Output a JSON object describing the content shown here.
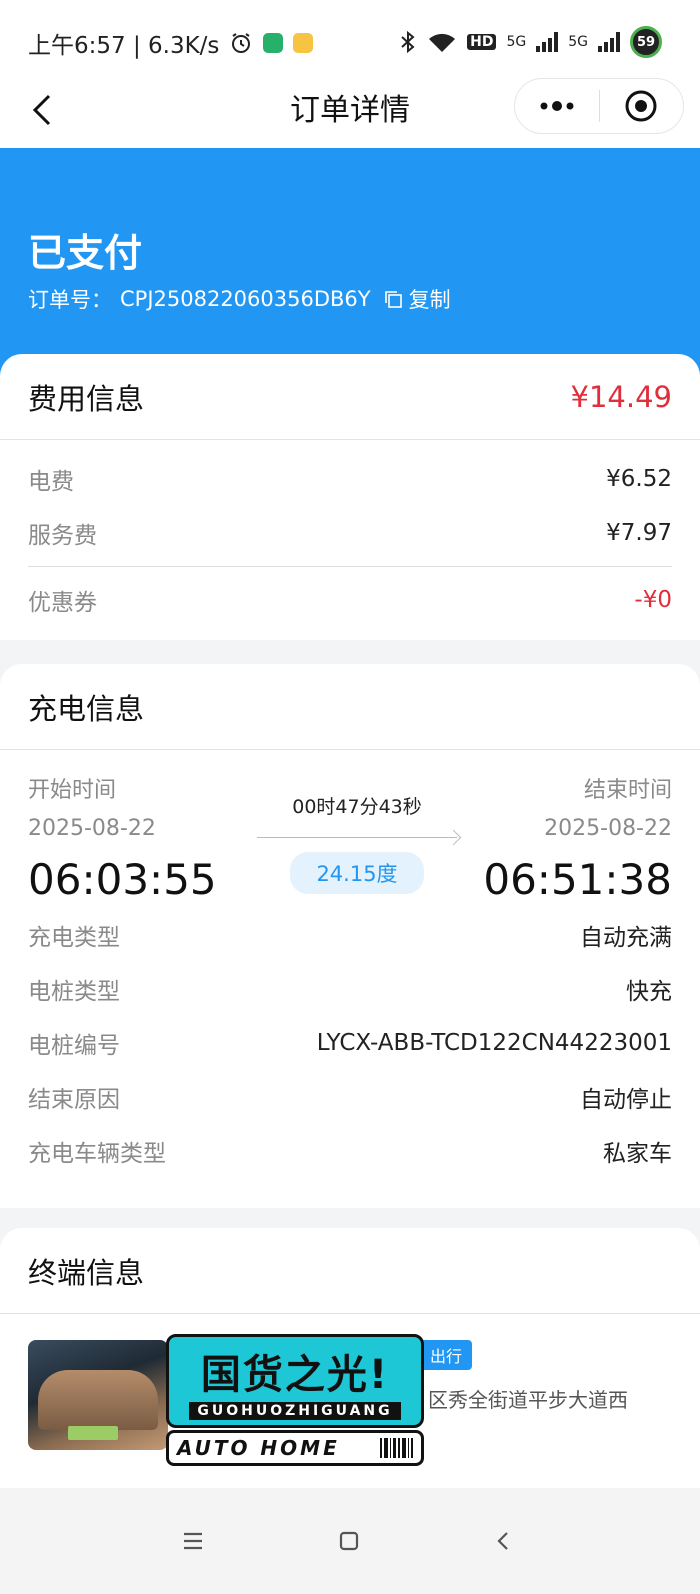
{
  "status_bar": {
    "time_speed": "上午6:57 | 6.3K/s",
    "battery": "59",
    "network_labels": [
      "HD",
      "5G",
      "5G"
    ]
  },
  "nav": {
    "title": "订单详情",
    "icons": [
      "back-icon",
      "more-icon",
      "close-target-icon"
    ]
  },
  "header": {
    "status": "已支付",
    "order_label": "订单号：",
    "order_no": "CPJ250822060356DB6Y",
    "copy_label": "复制",
    "bg_color": "#2196f3"
  },
  "fee": {
    "title": "费用信息",
    "total": "¥14.49",
    "rows": [
      {
        "key": "电费",
        "value": "¥6.52"
      },
      {
        "key": "服务费",
        "value": "¥7.97"
      }
    ],
    "coupon": {
      "key": "优惠券",
      "value": "-¥0"
    },
    "accent": "#e02e3a"
  },
  "charge": {
    "title": "充电信息",
    "start_label": "开始时间",
    "start_date": "2025-08-22",
    "start_time": "06:03:55",
    "end_label": "结束时间",
    "end_date": "2025-08-22",
    "end_time": "06:51:38",
    "duration": "00时47分43秒",
    "energy": "24.15度",
    "rows": [
      {
        "key": "充电类型",
        "value": "自动充满"
      },
      {
        "key": "电桩类型",
        "value": "快充"
      },
      {
        "key": "电桩编号",
        "value": "LYCX-ABB-TCD122CN44223001"
      },
      {
        "key": "结束原因",
        "value": "自动停止"
      },
      {
        "key": "充电车辆类型",
        "value": "私家车"
      }
    ]
  },
  "terminal": {
    "title": "终端信息",
    "tag": "出行",
    "address": "区秀全街道平步大道西",
    "watermark_cn": "国货之光!",
    "watermark_py": "GUOHUOZHIGUANG",
    "watermark_en": "AUTO HOME"
  },
  "system_nav": {
    "icons": [
      "menu-icon",
      "home-icon",
      "back-nav-icon"
    ]
  }
}
